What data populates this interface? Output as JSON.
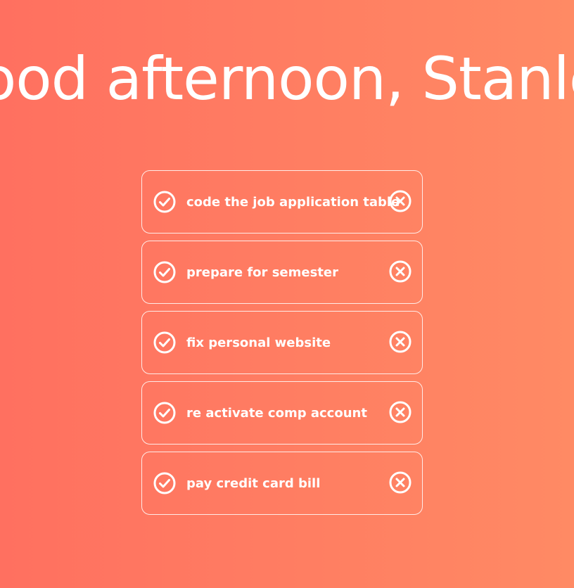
{
  "greeting": "Good afternoon, Stanley",
  "todos": [
    {
      "text": "code the job application table",
      "check_icon": "check-circle-icon",
      "remove_icon": "x-circle-icon"
    },
    {
      "text": "prepare for semester",
      "check_icon": "check-circle-icon",
      "remove_icon": "x-circle-icon"
    },
    {
      "text": "fix personal website",
      "check_icon": "check-circle-icon",
      "remove_icon": "x-circle-icon"
    },
    {
      "text": "re activate comp account",
      "check_icon": "check-circle-icon",
      "remove_icon": "x-circle-icon"
    },
    {
      "text": "pay credit card bill",
      "check_icon": "check-circle-icon",
      "remove_icon": "x-circle-icon"
    }
  ],
  "colors": {
    "background_start": "#ff7060",
    "background_end": "#ff8a64",
    "foreground": "#ffffff"
  }
}
